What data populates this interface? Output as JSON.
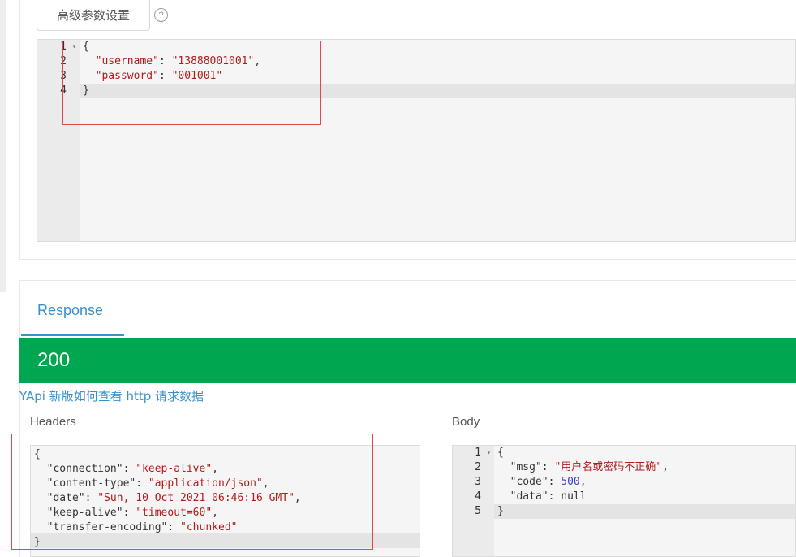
{
  "toolbar": {
    "advanced_label": "高级参数设置",
    "help_glyph": "?"
  },
  "request_body": {
    "lines": [
      {
        "num": "1",
        "fold": "▾",
        "parts": [
          {
            "t": "{",
            "c": "p"
          }
        ]
      },
      {
        "num": "2",
        "fold": "",
        "parts": [
          {
            "t": "  ",
            "c": "p"
          },
          {
            "t": "\"username\"",
            "c": "k"
          },
          {
            "t": ": ",
            "c": "p"
          },
          {
            "t": "\"13888001001\"",
            "c": "s"
          },
          {
            "t": ",",
            "c": "p"
          }
        ]
      },
      {
        "num": "3",
        "fold": "",
        "parts": [
          {
            "t": "  ",
            "c": "p"
          },
          {
            "t": "\"password\"",
            "c": "k"
          },
          {
            "t": ": ",
            "c": "p"
          },
          {
            "t": "\"001001\"",
            "c": "s"
          }
        ]
      },
      {
        "num": "4",
        "fold": "",
        "parts": [
          {
            "t": "}",
            "c": "p"
          }
        ]
      }
    ]
  },
  "response": {
    "tab_label": "Response",
    "status_code": "200",
    "help_link": "YApi 新版如何查看 http 请求数据",
    "headers_title": "Headers",
    "body_title": "Body",
    "headers_lines": [
      {
        "parts": [
          {
            "t": "{",
            "c": "p"
          }
        ]
      },
      {
        "parts": [
          {
            "t": "  ",
            "c": "p"
          },
          {
            "t": "\"connection\"",
            "c": "p"
          },
          {
            "t": ": ",
            "c": "p"
          },
          {
            "t": "\"keep-alive\"",
            "c": "s"
          },
          {
            "t": ",",
            "c": "p"
          }
        ]
      },
      {
        "parts": [
          {
            "t": "  ",
            "c": "p"
          },
          {
            "t": "\"content-type\"",
            "c": "p"
          },
          {
            "t": ": ",
            "c": "p"
          },
          {
            "t": "\"application/json\"",
            "c": "s"
          },
          {
            "t": ",",
            "c": "p"
          }
        ]
      },
      {
        "parts": [
          {
            "t": "  ",
            "c": "p"
          },
          {
            "t": "\"date\"",
            "c": "p"
          },
          {
            "t": ": ",
            "c": "p"
          },
          {
            "t": "\"Sun, 10 Oct 2021 06:46:16 GMT\"",
            "c": "s"
          },
          {
            "t": ",",
            "c": "p"
          }
        ]
      },
      {
        "parts": [
          {
            "t": "  ",
            "c": "p"
          },
          {
            "t": "\"keep-alive\"",
            "c": "p"
          },
          {
            "t": ": ",
            "c": "p"
          },
          {
            "t": "\"timeout=60\"",
            "c": "s"
          },
          {
            "t": ",",
            "c": "p"
          }
        ]
      },
      {
        "parts": [
          {
            "t": "  ",
            "c": "p"
          },
          {
            "t": "\"transfer-encoding\"",
            "c": "p"
          },
          {
            "t": ": ",
            "c": "p"
          },
          {
            "t": "\"chunked\"",
            "c": "s"
          }
        ]
      },
      {
        "parts": [
          {
            "t": "}",
            "c": "p"
          }
        ]
      }
    ],
    "body_lines": [
      {
        "num": "1",
        "fold": "▾",
        "parts": [
          {
            "t": "{",
            "c": "p"
          }
        ]
      },
      {
        "num": "2",
        "fold": "",
        "parts": [
          {
            "t": "  ",
            "c": "p"
          },
          {
            "t": "\"msg\"",
            "c": "p"
          },
          {
            "t": ": ",
            "c": "p"
          },
          {
            "t": "\"用户名或密码不正确\"",
            "c": "s"
          },
          {
            "t": ",",
            "c": "p"
          }
        ]
      },
      {
        "num": "3",
        "fold": "",
        "parts": [
          {
            "t": "  ",
            "c": "p"
          },
          {
            "t": "\"code\"",
            "c": "p"
          },
          {
            "t": ": ",
            "c": "p"
          },
          {
            "t": "500",
            "c": "n"
          },
          {
            "t": ",",
            "c": "p"
          }
        ]
      },
      {
        "num": "4",
        "fold": "",
        "parts": [
          {
            "t": "  ",
            "c": "p"
          },
          {
            "t": "\"data\"",
            "c": "p"
          },
          {
            "t": ": ",
            "c": "p"
          },
          {
            "t": "null",
            "c": "p"
          }
        ]
      },
      {
        "num": "5",
        "fold": "",
        "parts": [
          {
            "t": "}",
            "c": "p"
          }
        ]
      }
    ]
  },
  "colors": {
    "status_green": "#00a650",
    "accent_blue": "#3a91c9",
    "annotation_red": "#e0484f"
  }
}
